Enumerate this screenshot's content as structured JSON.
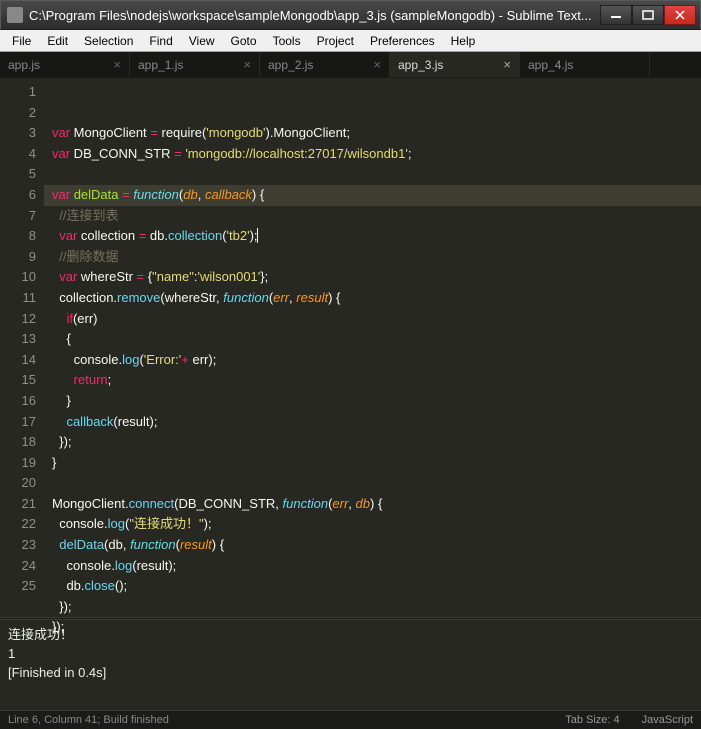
{
  "window": {
    "title": "C:\\Program Files\\nodejs\\workspace\\sampleMongodb\\app_3.js (sampleMongodb) - Sublime Text..."
  },
  "menu": [
    "File",
    "Edit",
    "Selection",
    "Find",
    "View",
    "Goto",
    "Tools",
    "Project",
    "Preferences",
    "Help"
  ],
  "tabs": [
    {
      "label": "app.js",
      "active": false,
      "close": "×"
    },
    {
      "label": "app_1.js",
      "active": false,
      "close": "×"
    },
    {
      "label": "app_2.js",
      "active": false,
      "close": "×"
    },
    {
      "label": "app_3.js",
      "active": true,
      "close": "×"
    },
    {
      "label": "app_4.js",
      "active": false,
      "close": ""
    }
  ],
  "lines": [
    "1",
    "2",
    "3",
    "4",
    "5",
    "6",
    "7",
    "8",
    "9",
    "10",
    "11",
    "12",
    "13",
    "14",
    "15",
    "16",
    "17",
    "18",
    "19",
    "20",
    "21",
    "22",
    "23",
    "24",
    "25"
  ],
  "code": {
    "l1a": "var",
    "l1b": " MongoClient ",
    "l1c": "=",
    "l1d": " require(",
    "l1e": "'mongodb'",
    "l1f": ").MongoClient;",
    "l2a": "var",
    "l2b": " DB_CONN_STR ",
    "l2c": "=",
    "l2d": " ",
    "l2e": "'mongodb://localhost:27017/wilsondb1'",
    "l2f": ";",
    "l4a": "var",
    "l4b": " ",
    "l4c": "delData",
    "l4d": " ",
    "l4e": "=",
    "l4f": " ",
    "l4g": "function",
    "l4h": "(",
    "l4i": "db",
    "l4j": ", ",
    "l4k": "callback",
    "l4l": ") {",
    "l5a": "  ",
    "l5b": "//连接到表",
    "l6a": "  ",
    "l6b": "var",
    "l6c": " collection ",
    "l6d": "=",
    "l6e": " db.",
    "l6f": "collection",
    "l6g": "(",
    "l6h": "'tb2'",
    "l6i": ");",
    "l7a": "  ",
    "l7b": "//删除数据",
    "l8a": "  ",
    "l8b": "var",
    "l8c": " whereStr ",
    "l8d": "=",
    "l8e": " {",
    "l8f": "\"name\"",
    "l8g": ":",
    "l8h": "'wilson001'",
    "l8i": "};",
    "l9a": "  collection.",
    "l9b": "remove",
    "l9c": "(whereStr, ",
    "l9d": "function",
    "l9e": "(",
    "l9f": "err",
    "l9g": ", ",
    "l9h": "result",
    "l9i": ") {",
    "l10a": "    ",
    "l10b": "if",
    "l10c": "(err)",
    "l11a": "    {",
    "l12a": "      console.",
    "l12b": "log",
    "l12c": "(",
    "l12d": "'Error:'",
    "l12e": "+",
    "l12f": " err);",
    "l13a": "      ",
    "l13b": "return",
    "l13c": ";",
    "l14a": "    }",
    "l15a": "    ",
    "l15b": "callback",
    "l15c": "(result);",
    "l16a": "  });",
    "l17a": "}",
    "l19a": "MongoClient.",
    "l19b": "connect",
    "l19c": "(DB_CONN_STR, ",
    "l19d": "function",
    "l19e": "(",
    "l19f": "err",
    "l19g": ", ",
    "l19h": "db",
    "l19i": ") {",
    "l20a": "  console.",
    "l20b": "log",
    "l20c": "(",
    "l20d": "\"连接成功！\"",
    "l20e": ");",
    "l21a": "  ",
    "l21b": "delData",
    "l21c": "(db, ",
    "l21d": "function",
    "l21e": "(",
    "l21f": "result",
    "l21g": ") {",
    "l22a": "    console.",
    "l22b": "log",
    "l22c": "(result);",
    "l23a": "    db.",
    "l23b": "close",
    "l23c": "();",
    "l24a": "  });",
    "l25a": "});"
  },
  "console": {
    "line1": "连接成功！",
    "line2": "1",
    "line3": "[Finished in 0.4s]"
  },
  "status": {
    "left": "Line 6, Column 41; Build finished",
    "tab": "Tab Size: 4",
    "lang": "JavaScript"
  }
}
